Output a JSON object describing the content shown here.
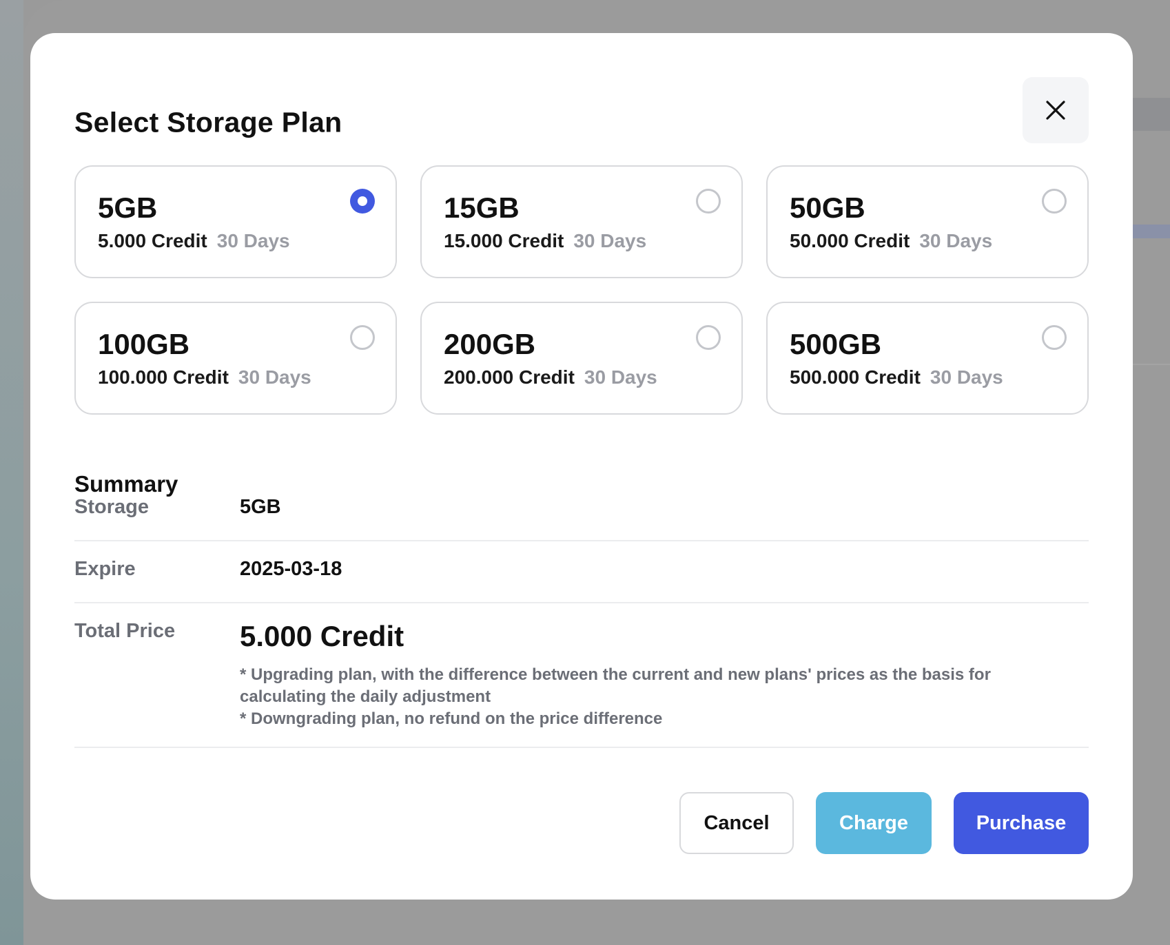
{
  "modal": {
    "title": "Select Storage Plan",
    "close_icon": "close-icon"
  },
  "plans": [
    {
      "size": "5GB",
      "credit": "5.000 Credit",
      "days": "30 Days",
      "selected": true
    },
    {
      "size": "15GB",
      "credit": "15.000 Credit",
      "days": "30 Days",
      "selected": false
    },
    {
      "size": "50GB",
      "credit": "50.000 Credit",
      "days": "30 Days",
      "selected": false
    },
    {
      "size": "100GB",
      "credit": "100.000 Credit",
      "days": "30 Days",
      "selected": false
    },
    {
      "size": "200GB",
      "credit": "200.000 Credit",
      "days": "30 Days",
      "selected": false
    },
    {
      "size": "500GB",
      "credit": "500.000 Credit",
      "days": "30 Days",
      "selected": false
    }
  ],
  "summary": {
    "title": "Summary",
    "storage_label": "Storage",
    "storage_value": "5GB",
    "expire_label": "Expire",
    "expire_value": "2025-03-18",
    "total_label": "Total Price",
    "total_value": "5.000 Credit",
    "note_upgrade": "* Upgrading plan, with the difference between the current and new plans' prices as the basis for calculating the daily adjustment",
    "note_downgrade": "* Downgrading plan, no refund on the price difference"
  },
  "buttons": {
    "cancel": "Cancel",
    "charge": "Charge",
    "purchase": "Purchase"
  },
  "colors": {
    "accent": "#4159e0",
    "charge": "#5bb8de",
    "muted_text": "#6b6e76",
    "days_text": "#9a9ca3",
    "border": "#d8d9dc"
  }
}
